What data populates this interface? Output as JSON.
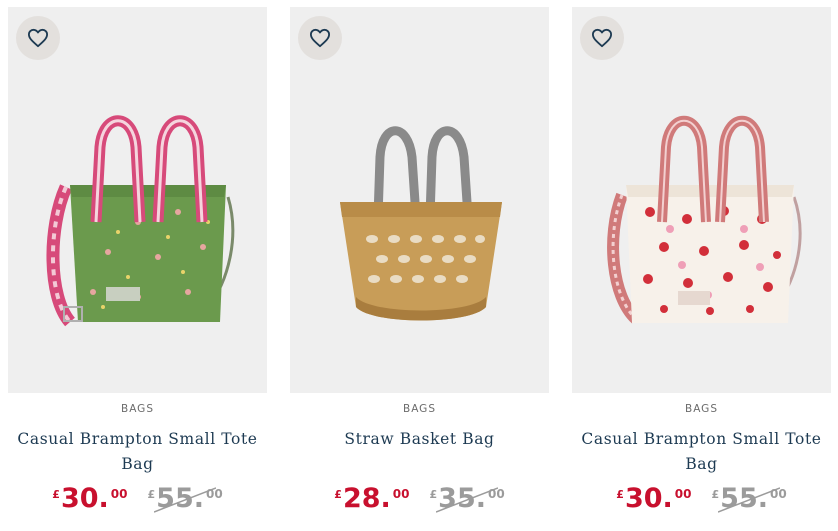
{
  "products": [
    {
      "category": "BAGS",
      "title_line1": "Casual Brampton Small Tote",
      "title_line2": "Bag",
      "price": {
        "currency": "£",
        "integer": "30.",
        "decimal": "00"
      },
      "was_price": {
        "currency": "£",
        "integer": "55.",
        "decimal": "00"
      },
      "image_alt": "green floral tote bag with pink striped strap",
      "wishlist_icon": "heart-outline-icon"
    },
    {
      "category": "BAGS",
      "title_line1": "Straw Basket Bag",
      "title_line2": "",
      "price": {
        "currency": "£",
        "integer": "28.",
        "decimal": "00"
      },
      "was_price": {
        "currency": "£",
        "integer": "35.",
        "decimal": "00"
      },
      "image_alt": "woven straw basket bag with grey handles",
      "wishlist_icon": "heart-outline-icon"
    },
    {
      "category": "BAGS",
      "title_line1": "Casual Brampton Small Tote",
      "title_line2": "Bag",
      "price": {
        "currency": "£",
        "integer": "30.",
        "decimal": "00"
      },
      "was_price": {
        "currency": "£",
        "integer": "55.",
        "decimal": "00"
      },
      "image_alt": "white strawberry print tote bag with red striped strap",
      "wishlist_icon": "heart-outline-icon"
    }
  ],
  "colors": {
    "price_red": "#c8102e",
    "title_navy": "#1d3a52",
    "was_grey": "#9b9b9b",
    "image_bg": "#efefef"
  }
}
